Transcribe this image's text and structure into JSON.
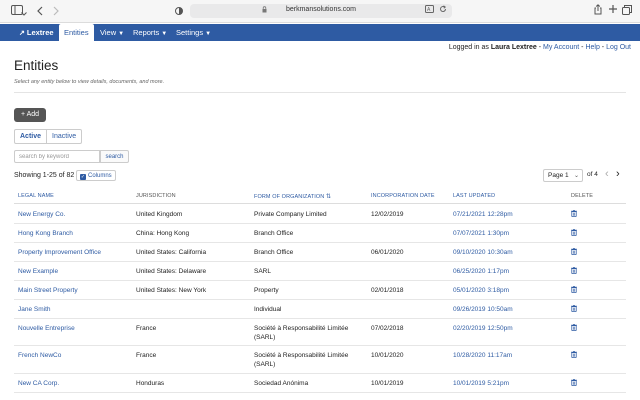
{
  "browser": {
    "url": "berkmansolutions.com"
  },
  "nav": {
    "brand": "Lextree",
    "items": [
      {
        "label": "Entities",
        "active": true
      },
      {
        "label": "View",
        "dropdown": true
      },
      {
        "label": "Reports",
        "dropdown": true
      },
      {
        "label": "Settings",
        "dropdown": true
      }
    ]
  },
  "login": {
    "prefix": "Logged in as",
    "user": "Laura Lextree",
    "my_account": "My Account",
    "help": "Help",
    "logout": "Log Out"
  },
  "page": {
    "title": "Entities",
    "subtitle": "Select any entity below to view details, documents, and more.",
    "add_label": "+ Add",
    "filter_active": "Active",
    "filter_inactive": "Inactive",
    "search_placeholder": "search by keyword",
    "search_button": "search",
    "showing": "Showing 1-25 of 82",
    "columns_button": "Columns",
    "page_select": "Page 1",
    "page_of": "of 4"
  },
  "table": {
    "headers": [
      "Legal Name",
      "Jurisdiction",
      "Form of Organization",
      "Incorporation Date",
      "Last Updated",
      "Delete"
    ],
    "rows": [
      {
        "name": "New Energy Co.",
        "jurisdiction": "United Kingdom",
        "form": "Private Company Limited",
        "form2": "",
        "inc": "12/02/2019",
        "updated": "07/21/2021 12:28pm"
      },
      {
        "name": "Hong Kong Branch",
        "jurisdiction": "China: Hong Kong",
        "form": "Branch Office",
        "form2": "",
        "inc": "",
        "updated": "07/07/2021 1:30pm"
      },
      {
        "name": "Property Improvement Office",
        "jurisdiction": "United States: California",
        "form": "Branch Office",
        "form2": "",
        "inc": "06/01/2020",
        "updated": "09/10/2020 10:30am"
      },
      {
        "name": "New Example",
        "jurisdiction": "United States: Delaware",
        "form": "SARL",
        "form2": "",
        "inc": "",
        "updated": "06/25/2020 1:17pm"
      },
      {
        "name": "Main Street Property",
        "jurisdiction": "United States: New York",
        "form": "Property",
        "form2": "",
        "inc": "02/01/2018",
        "updated": "05/01/2020 3:18pm"
      },
      {
        "name": "Jane Smith",
        "jurisdiction": "",
        "form": "Individual",
        "form2": "",
        "inc": "",
        "updated": "09/26/2019 10:50am"
      },
      {
        "name": "Nouvelle Entreprise",
        "jurisdiction": "France",
        "form": "Société à Responsabilité Limitée",
        "form2": "(SARL)",
        "inc": "07/02/2018",
        "updated": "02/20/2019 12:50pm"
      },
      {
        "name": "French NewCo",
        "jurisdiction": "France",
        "form": "Société à Responsabilité Limitée",
        "form2": "(SARL)",
        "inc": "10/01/2020",
        "updated": "10/28/2020 11:17am"
      },
      {
        "name": "New CA Corp.",
        "jurisdiction": "Honduras",
        "form": "Sociedad Anónima",
        "form2": "",
        "inc": "10/01/2019",
        "updated": "10/01/2019 5:21pm"
      }
    ]
  },
  "colors": {
    "brand_blue": "#2e5ba3",
    "add_button": "#555555"
  }
}
